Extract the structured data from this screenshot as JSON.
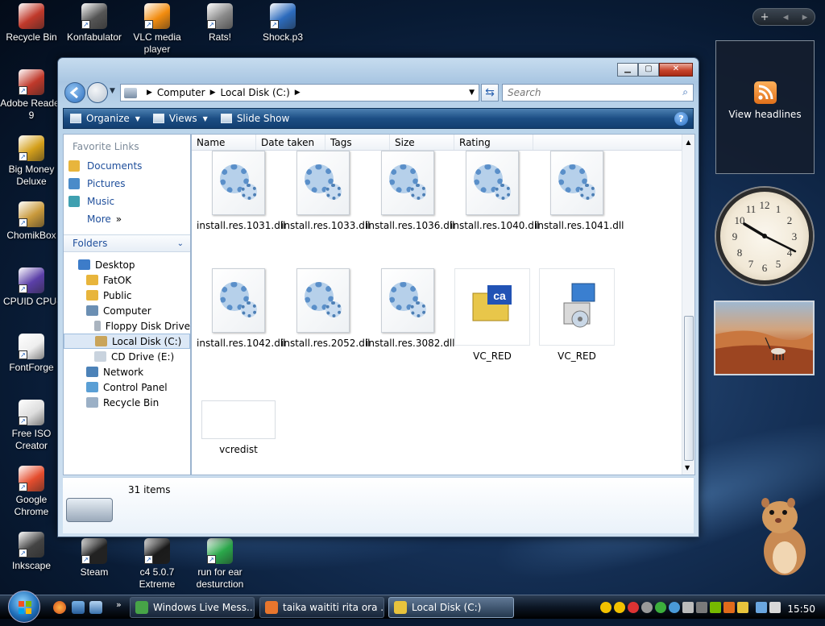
{
  "desktop": {
    "icons": [
      {
        "label": "Recycle Bin",
        "color": "#c0392b"
      },
      {
        "label": "Konfabulator",
        "color": "#555555"
      },
      {
        "label": "VLC media player",
        "color": "#f28c0f"
      },
      {
        "label": "Rats!",
        "color": "#8a8a8a"
      },
      {
        "label": "Shock.p3",
        "color": "#2c6bbd"
      },
      {
        "label": "Adobe Reader 9",
        "color": "#c0392b"
      },
      {
        "label": "Big Money Deluxe",
        "color": "#d4a01b"
      },
      {
        "label": "ChomikBox",
        "color": "#c99a3c"
      },
      {
        "label": "CPUID CPU-",
        "color": "#5b3fa8"
      },
      {
        "label": "FontForge",
        "color": "#eeeeee"
      },
      {
        "label": "Free ISO Creator",
        "color": "#dddddd"
      },
      {
        "label": "Google Chrome",
        "color": "#e54d2e"
      },
      {
        "label": "Inkscape",
        "color": "#444444"
      },
      {
        "label": "Steam",
        "color": "#222222"
      },
      {
        "label": "c4 5.0.7 Extreme",
        "color": "#1a1a1a"
      },
      {
        "label": "run for ear desturction",
        "color": "#2aa84a"
      }
    ]
  },
  "gadgets": {
    "feed": {
      "label": "View headlines"
    }
  },
  "window": {
    "address": {
      "segments": [
        "Computer",
        "Local Disk (C:)"
      ]
    },
    "search_placeholder": "Search",
    "toolbar": {
      "organize": "Organize",
      "views": "Views",
      "slideshow": "Slide Show"
    },
    "favorite_links": {
      "title": "Favorite Links",
      "items": [
        {
          "label": "Documents",
          "color": "#e8b53c"
        },
        {
          "label": "Pictures",
          "color": "#4a8bc9"
        },
        {
          "label": "Music",
          "color": "#3fa0b0"
        },
        {
          "label": "More",
          "suffix": "»"
        }
      ]
    },
    "folders": {
      "title": "Folders",
      "items": [
        {
          "label": "Desktop",
          "indent": 0,
          "color": "#3d7cc9"
        },
        {
          "label": "FatOK",
          "indent": 1,
          "color": "#e8b53c"
        },
        {
          "label": "Public",
          "indent": 1,
          "color": "#e8b53c"
        },
        {
          "label": "Computer",
          "indent": 1,
          "color": "#6b8fb3"
        },
        {
          "label": "Floppy Disk Drive",
          "indent": 2,
          "color": "#aab4bf"
        },
        {
          "label": "Local Disk (C:)",
          "indent": 2,
          "color": "#c9a45a",
          "selected": true
        },
        {
          "label": "CD Drive (E:)",
          "indent": 2,
          "color": "#c9d3de"
        },
        {
          "label": "Network",
          "indent": 1,
          "color": "#4c82b8"
        },
        {
          "label": "Control Panel",
          "indent": 1,
          "color": "#5a9fd5"
        },
        {
          "label": "Recycle Bin",
          "indent": 1,
          "color": "#9bb0c6"
        }
      ]
    },
    "columns": [
      "Name",
      "Date taken",
      "Tags",
      "Size",
      "Rating"
    ],
    "files": [
      {
        "name": "install.res.1031.dll",
        "kind": "dll"
      },
      {
        "name": "install.res.1033.dll",
        "kind": "dll"
      },
      {
        "name": "install.res.1036.dll",
        "kind": "dll"
      },
      {
        "name": "install.res.1040.dll",
        "kind": "dll"
      },
      {
        "name": "install.res.1041.dll",
        "kind": "dll"
      },
      {
        "name": "install.res.1042.dll",
        "kind": "dll"
      },
      {
        "name": "install.res.2052.dll",
        "kind": "dll"
      },
      {
        "name": "install.res.3082.dll",
        "kind": "dll"
      },
      {
        "name": "VC_RED",
        "kind": "cab"
      },
      {
        "name": "VC_RED",
        "kind": "msi"
      },
      {
        "name": "vcredist",
        "kind": "blank"
      }
    ],
    "status": {
      "item_count": "31 items"
    }
  },
  "taskbar": {
    "buttons": [
      {
        "label": "Windows Live Mess...",
        "color": "#47a447"
      },
      {
        "label": "taika waititi rita ora ...",
        "color": "#e8762d"
      },
      {
        "label": "Local Disk (C:)",
        "color": "#e8c33c",
        "active": true
      }
    ],
    "clock": "15:50"
  }
}
